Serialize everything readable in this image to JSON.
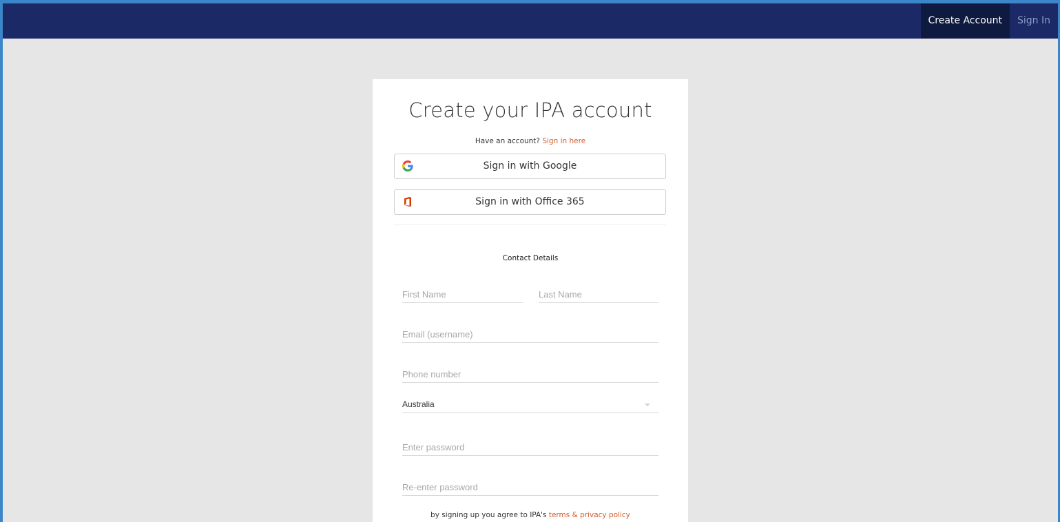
{
  "nav": {
    "create_account": "Create Account",
    "sign_in": "Sign In"
  },
  "card": {
    "title": "Create your IPA account",
    "have_account_text": "Have an account?",
    "sign_in_here": "Sign in here",
    "google_button": "Sign in with Google",
    "office_button": "Sign in with Office 365",
    "section_title": "Contact Details",
    "terms_prefix": "by signing up you agree to IPA's",
    "terms_link": "terms & privacy policy"
  },
  "form": {
    "first_name_placeholder": "First Name",
    "last_name_placeholder": "Last Name",
    "email_placeholder": "Email (username)",
    "phone_placeholder": "Phone number",
    "country_value": "Australia",
    "password_placeholder": "Enter password",
    "reenter_password_placeholder": "Re-enter password"
  },
  "icons": {
    "google": "google-icon",
    "office": "office365-icon",
    "dropdown": "chevron-down-icon"
  },
  "colors": {
    "topbar": "#1b2a66",
    "active_nav": "#0f1a40",
    "link": "#d25d2a",
    "office_red": "#d83b01"
  }
}
